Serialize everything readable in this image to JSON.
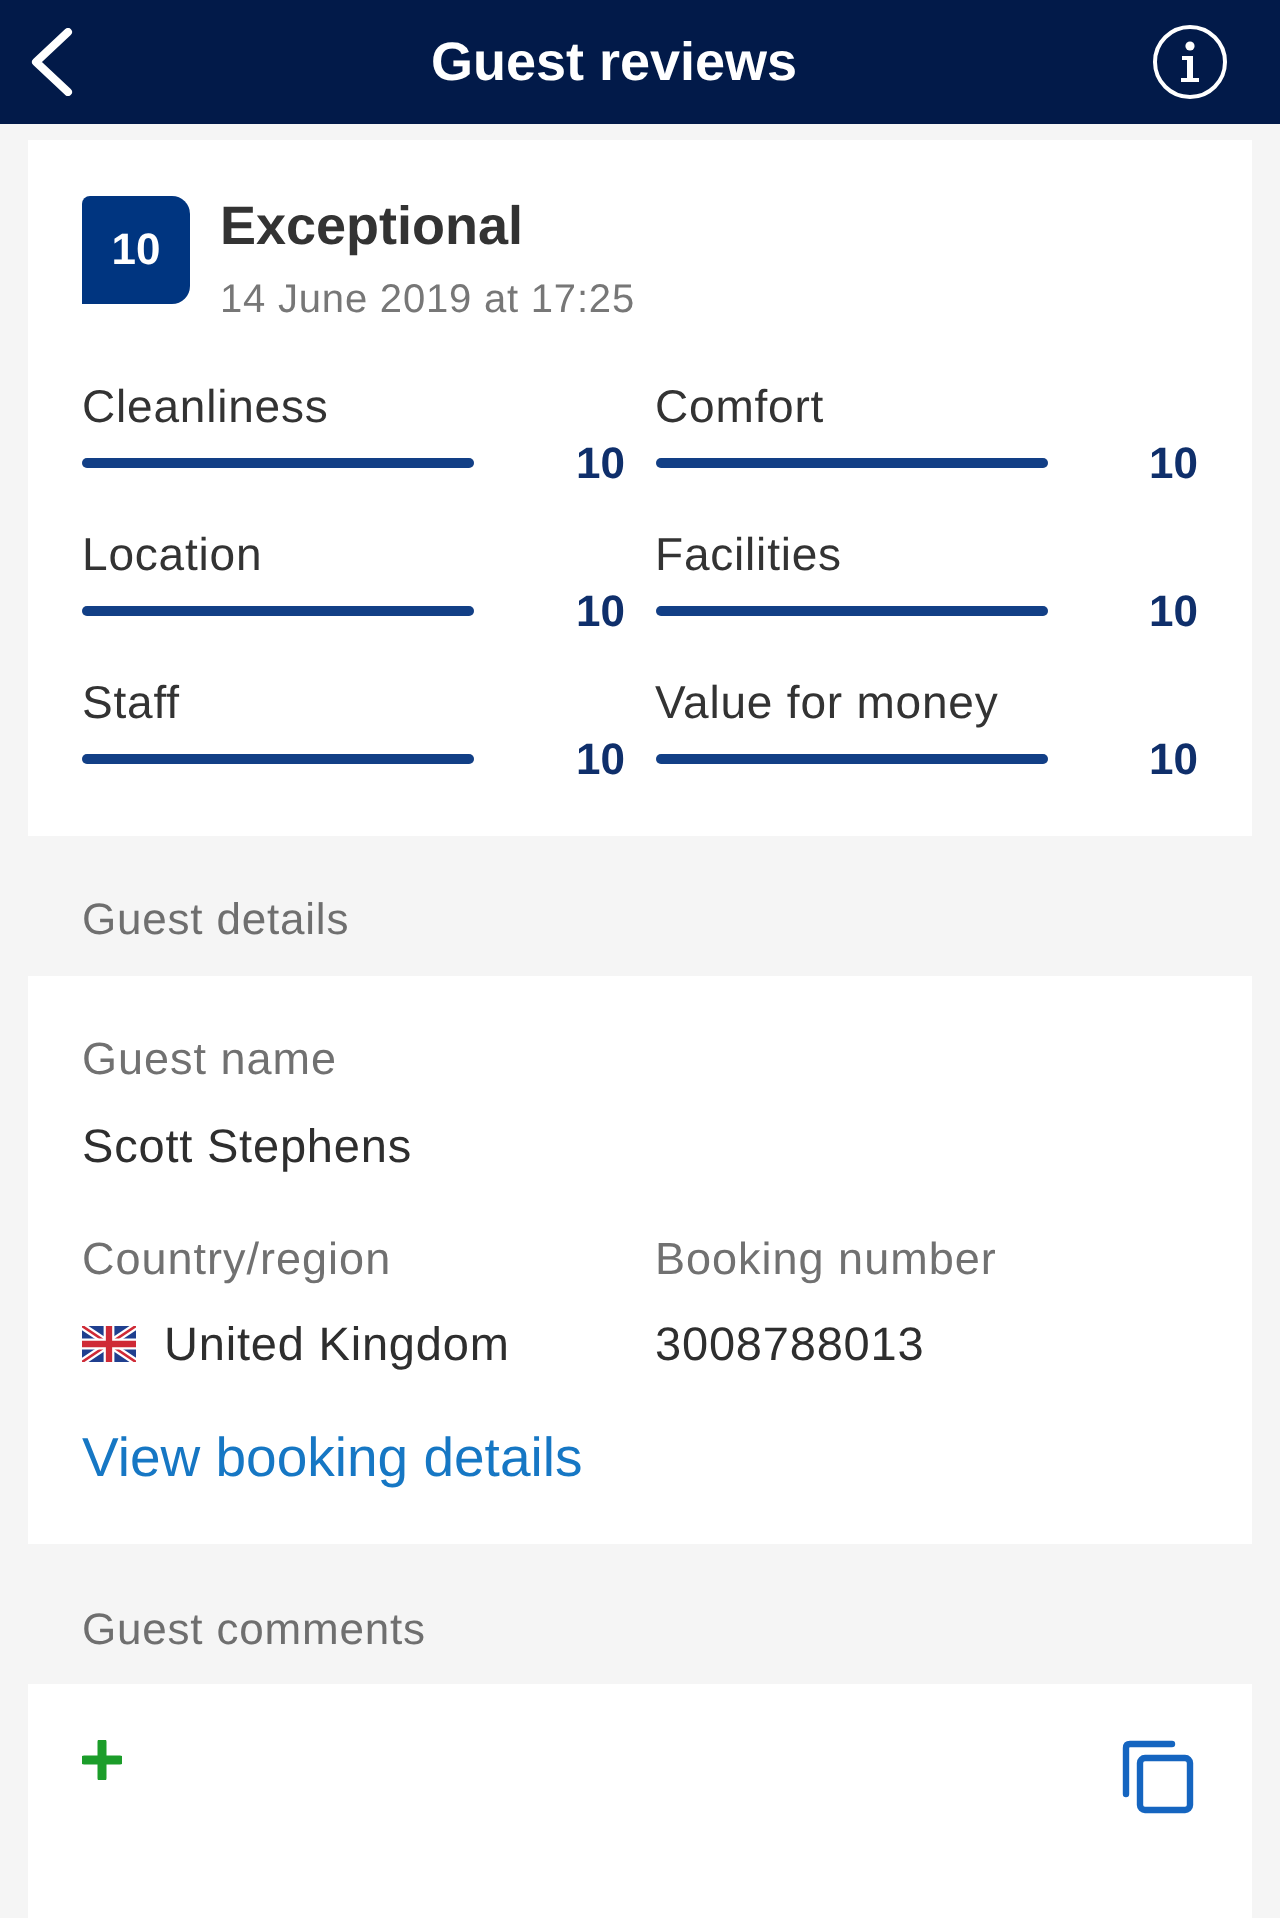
{
  "header": {
    "title": "Guest reviews"
  },
  "review": {
    "score": "10",
    "verdict": "Exceptional",
    "date": "14 June 2019 at 17:25",
    "categories": [
      {
        "name": "Cleanliness",
        "level": 1,
        "score": "10"
      },
      {
        "name": "Comfort",
        "level": 1,
        "score": "10"
      },
      {
        "name": "Location",
        "level": 1,
        "score": "10"
      },
      {
        "name": "Facilities",
        "level": 1,
        "score": "10"
      },
      {
        "name": "Staff",
        "level": 1,
        "score": "10"
      },
      {
        "name": "Value for money",
        "level": 1,
        "score": "10"
      }
    ]
  },
  "guest_details": {
    "heading": "Guest details",
    "name_label": "Guest name",
    "name": "Scott Stephens",
    "country_label": "Country/region",
    "country": "United Kingdom",
    "booking_label": "Booking number",
    "booking_number": "3008788013",
    "link": "View booking details"
  },
  "guest_comments": {
    "heading": "Guest comments"
  }
}
